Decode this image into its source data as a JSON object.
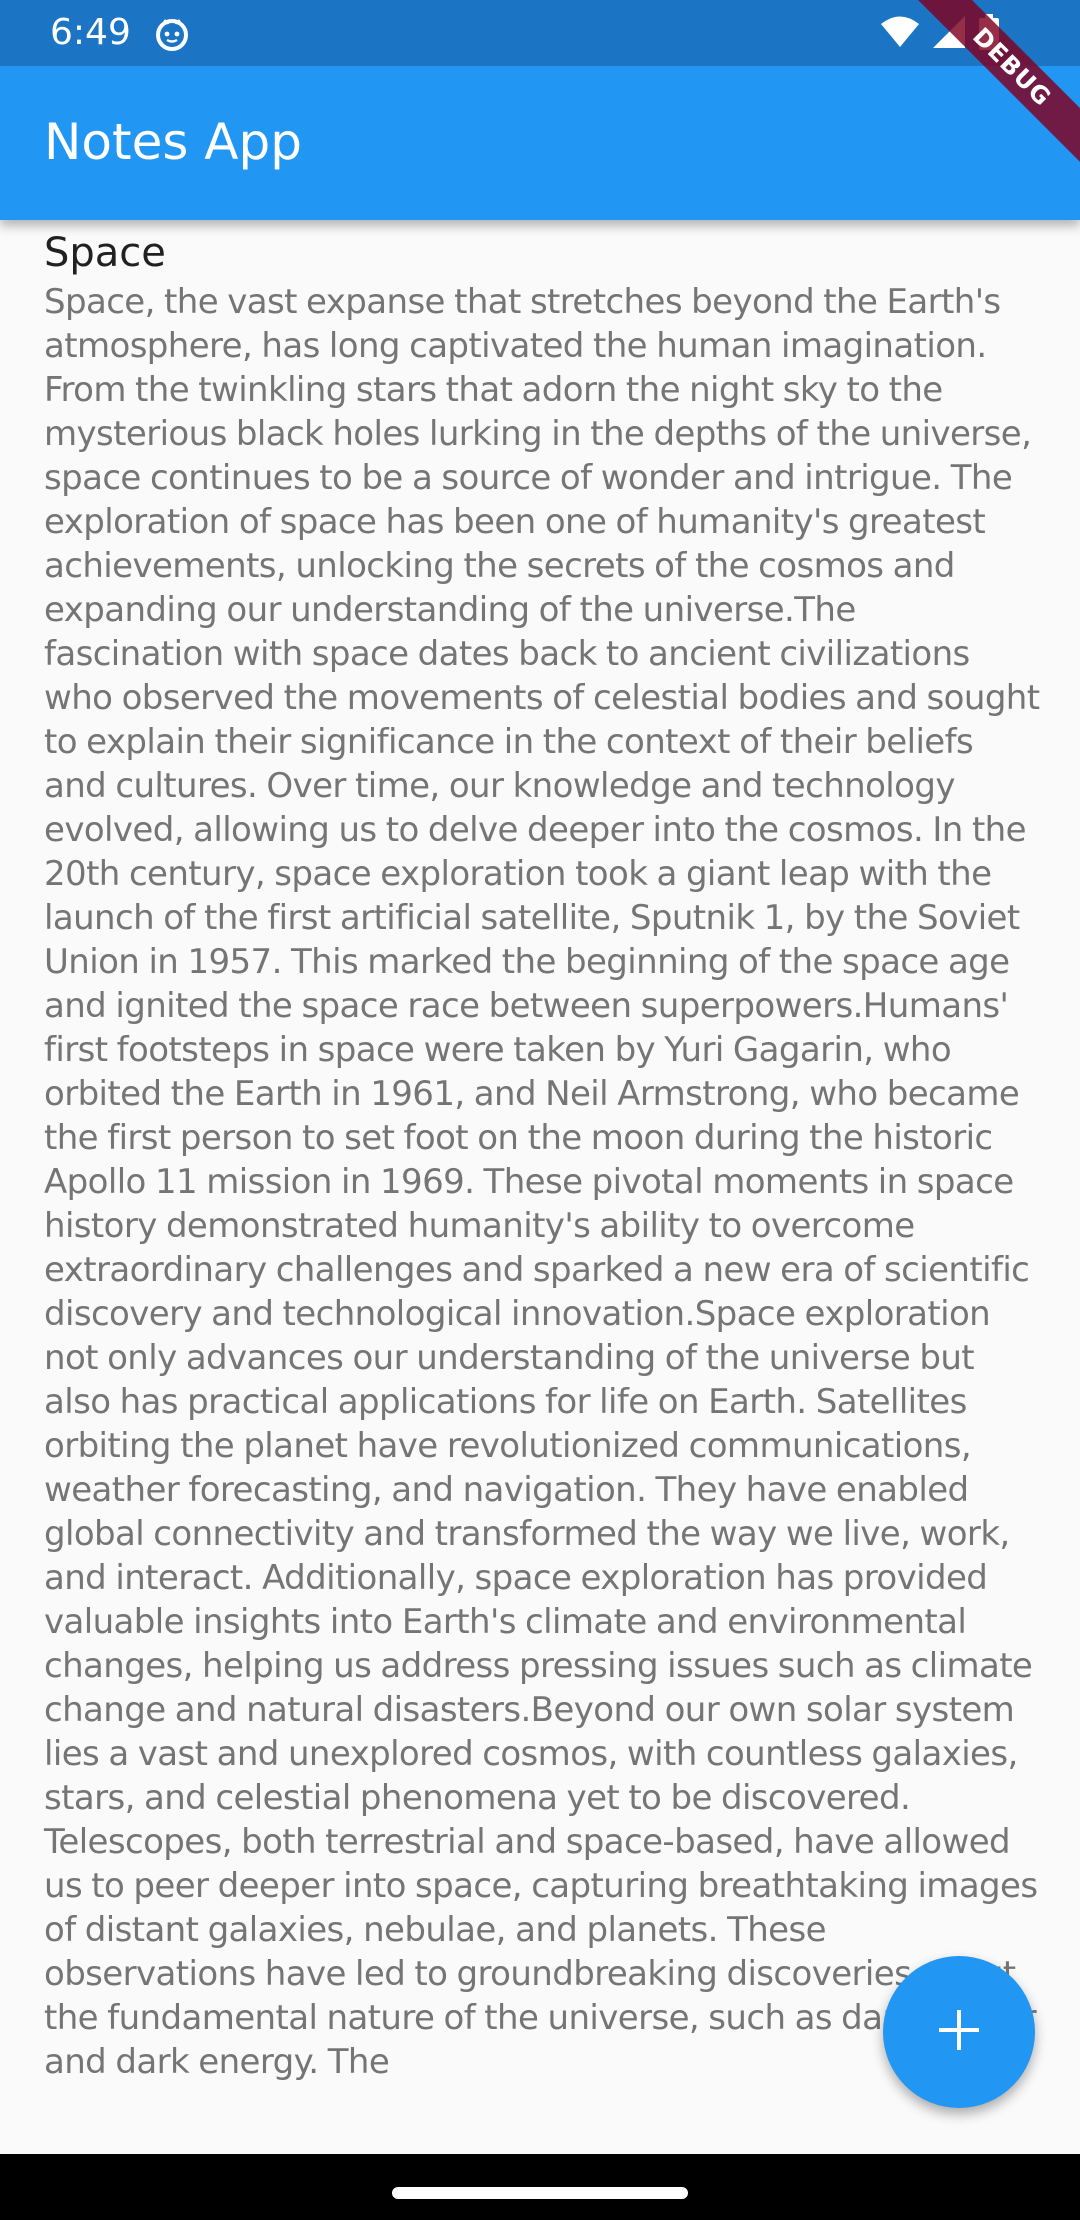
{
  "status_bar": {
    "time": "6:49",
    "icons": [
      "app-notification-icon",
      "wifi-icon",
      "signal-icon",
      "battery-icon"
    ],
    "color": "#1c74c4"
  },
  "app_bar": {
    "title": "Notes App",
    "color": "#2196f3"
  },
  "debug_banner": {
    "label": "DEBUG"
  },
  "notes": [
    {
      "title": "Space",
      "body": "Space, the vast expanse that stretches beyond the Earth's atmosphere, has long captivated the human imagination. From the twinkling stars that adorn the night sky to the mysterious black holes lurking in the depths of the universe, space continues to be a source of wonder and intrigue. The exploration of space has been one of humanity's greatest achievements, unlocking the secrets of the cosmos and expanding our understanding of the universe.The fascination with space dates back to ancient civilizations who observed the movements of celestial bodies and sought to explain their significance in the context of their beliefs and cultures. Over time, our knowledge and technology evolved, allowing us to delve deeper into the cosmos. In the 20th century, space exploration took a giant leap with the launch of the first artificial satellite, Sputnik 1, by the Soviet Union in 1957. This marked the beginning of the space age and ignited the space race between superpowers.Humans' first footsteps in space were taken by Yuri Gagarin, who orbited the Earth in 1961, and Neil Armstrong, who became the first person to set foot on the moon during the historic Apollo 11 mission in 1969. These pivotal moments in space history demonstrated humanity's ability to overcome extraordinary challenges and sparked a new era of scientific discovery and technological innovation.Space exploration not only advances our understanding of the universe but also has practical applications for life on Earth. Satellites orbiting the planet have revolutionized communications, weather forecasting, and navigation. They have enabled global connectivity and transformed the way we live, work, and interact. Additionally, space exploration has provided valuable insights into Earth's climate and environmental changes, helping us address pressing issues such as climate change and natural disasters.Beyond our own solar system lies a vast and unexplored cosmos, with countless galaxies, stars, and celestial phenomena yet to be discovered. Telescopes, both terrestrial and space-based, have allowed us to peer deeper into space, capturing breathtaking images of distant galaxies, nebulae, and planets. These observations have led to groundbreaking discoveries about the fundamental nature of the universe, such as dark matter and dark energy. The"
    }
  ],
  "fab": {
    "icon": "plus-icon",
    "color": "#2196f3"
  },
  "nav_bar": {
    "handle": "gesture-handle"
  }
}
